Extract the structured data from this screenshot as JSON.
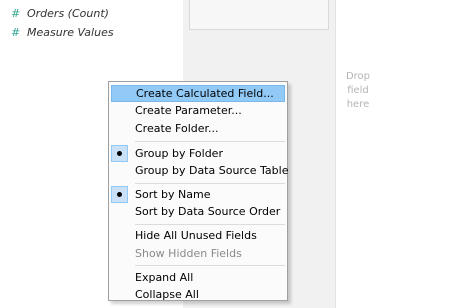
{
  "data_pane": {
    "fields": [
      {
        "icon": "#",
        "label": "Orders (Count)"
      },
      {
        "icon": "#",
        "label": "Measure Values"
      }
    ]
  },
  "canvas": {
    "drop_hint": [
      "Drop",
      "field",
      "here"
    ]
  },
  "context_menu": {
    "items": [
      {
        "label": "Create Calculated Field...",
        "state": "highlighted"
      },
      {
        "label": "Create Parameter..."
      },
      {
        "label": "Create Folder..."
      },
      {
        "label": "Group by Folder",
        "checked": true
      },
      {
        "label": "Group by Data Source Table"
      },
      {
        "label": "Sort by Name",
        "checked": true
      },
      {
        "label": "Sort by Data Source Order"
      },
      {
        "label": "Hide All Unused Fields"
      },
      {
        "label": "Show Hidden Fields",
        "state": "disabled"
      },
      {
        "label": "Expand All"
      },
      {
        "label": "Collapse All"
      }
    ]
  },
  "colors": {
    "measure_icon": "#2ea58d",
    "menu_highlight": "#91c9f7",
    "menu_border": "#a0a0a0",
    "drop_hint_text": "#b4b4b4"
  }
}
